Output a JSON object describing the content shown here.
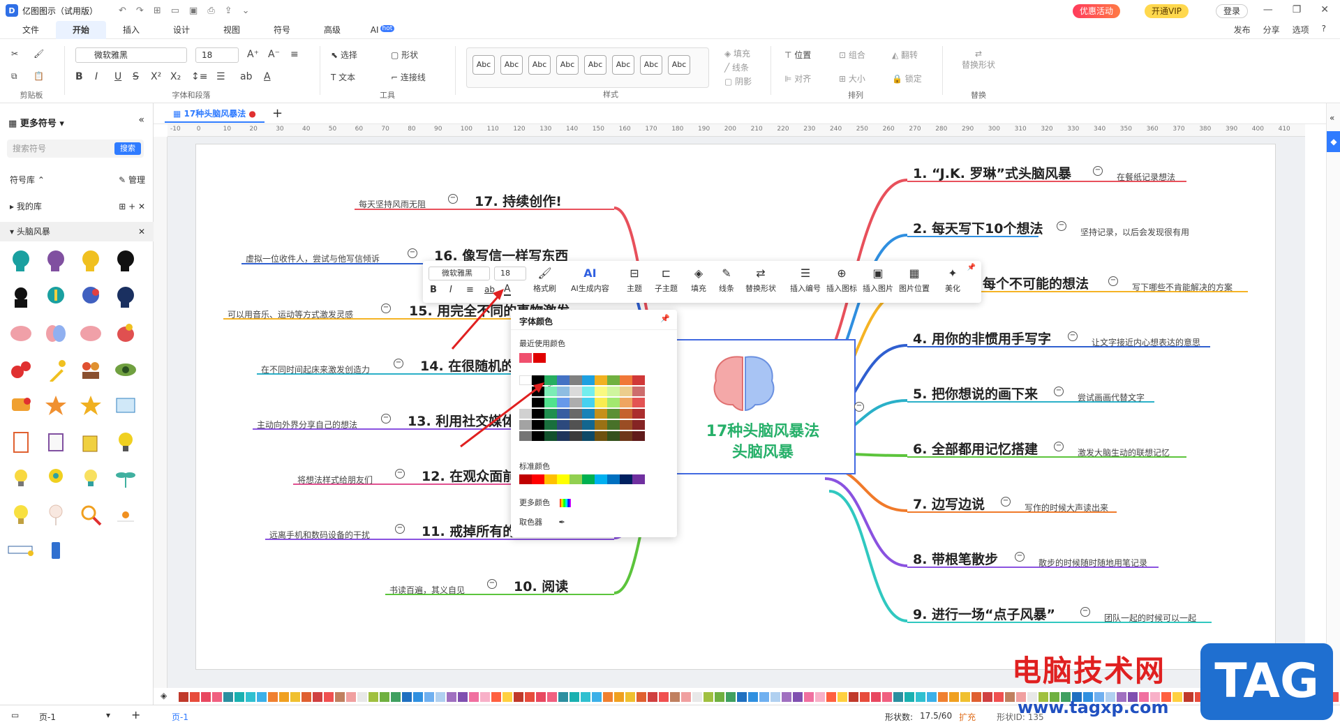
{
  "app": {
    "name": "亿图图示（试用版）",
    "promo": "优惠活动",
    "vip": "开通VIP",
    "login": "登录"
  },
  "menu": {
    "items": [
      "文件",
      "开始",
      "插入",
      "设计",
      "视图",
      "符号",
      "高级",
      "AI"
    ],
    "ai_hot": "hot",
    "right": [
      "发布",
      "分享",
      "选项",
      "?"
    ]
  },
  "ribbon": {
    "font_name": "微软雅黑",
    "font_size": "18",
    "groups": {
      "clipboard": "剪贴板",
      "font": "字体和段落",
      "tools": "工具",
      "styles": "样式",
      "arrange": "排列",
      "replace": "替换"
    },
    "select": "选择",
    "shape": "形状",
    "text": "文本",
    "connector": "连接线",
    "fill": "填充",
    "line": "线条",
    "shadow": "阴影",
    "position": "位置",
    "group": "组合",
    "flip": "翻转",
    "align": "对齐",
    "size": "大小",
    "lock": "锁定",
    "replace_shape": "替换形状",
    "style_sample": "Abc"
  },
  "left_panel": {
    "title": "更多符号",
    "search_placeholder": "搜索符号",
    "search_btn": "搜索",
    "library": "符号库",
    "manage": "管理",
    "my_library": "我的库",
    "category": "头脑风暴"
  },
  "doc": {
    "tab": "17种头脑风暴法"
  },
  "ruler_ticks": [
    "-10",
    "0",
    "10",
    "20",
    "30",
    "40",
    "50",
    "60",
    "70",
    "80",
    "90",
    "100",
    "110",
    "120",
    "130",
    "140",
    "150",
    "160",
    "170",
    "180",
    "190",
    "200",
    "210",
    "220",
    "230",
    "240",
    "250",
    "260",
    "270",
    "280",
    "290",
    "300",
    "310",
    "320",
    "330",
    "340",
    "350",
    "360",
    "370",
    "380",
    "390",
    "400",
    "410"
  ],
  "mindmap": {
    "center_line1": "17种头脑风暴法",
    "center_line2": "头脑风暴",
    "right": [
      {
        "title": "1. “J.K. 罗琳”式头脑风暴",
        "note": "在餐纸记录想法",
        "color": "#e8505b"
      },
      {
        "title": "2. 每天写下10个想法",
        "note": "坚持记录，以后会发现很有用",
        "color": "#2f8fe0"
      },
      {
        "title": "3. 每个不可能的想法",
        "note": "写下哪些不肯能解决的方案",
        "color": "#f5b324"
      },
      {
        "title": "4. 用你的非惯用手写字",
        "note": "让文字接近内心想表达的意思",
        "color": "#2f5fd0"
      },
      {
        "title": "5. 把你想说的画下来",
        "note": "尝试画画代替文字",
        "color": "#2ab0c8"
      },
      {
        "title": "6. 全部都用记忆搭建",
        "note": "激发大脑生动的联想记忆",
        "color": "#5cc43c"
      },
      {
        "title": "7. 边写边说",
        "note": "写作的时候大声读出来",
        "color": "#f07a2a"
      },
      {
        "title": "8. 带根笔散步",
        "note": "散步的时候随时随地用笔记录",
        "color": "#8a52e0"
      },
      {
        "title": "9. 进行一场“点子风暴”",
        "note": "团队一起的时候可以一起",
        "color": "#30c8c0"
      }
    ],
    "left": [
      {
        "title": "17. 持续创作!",
        "note": "每天坚持风雨无阻",
        "color": "#e8505b"
      },
      {
        "title": "16. 像写信一样写东西",
        "note": "虚拟一位收件人，尝试与他写信倾诉",
        "color": "#2f5fd0"
      },
      {
        "title": "15. 用完全不同的事物激发",
        "note": "可以用音乐、运动等方式激发灵感",
        "color": "#f5b324"
      },
      {
        "title": "14. 在很随机的时间起床",
        "note": "在不同时间起床来激发创造力",
        "color": "#2ab0c8"
      },
      {
        "title": "13. 利用社交媒体",
        "note": "主动向外界分享自己的想法",
        "color": "#8a52e0"
      },
      {
        "title": "12. 在观众面前",
        "note": "将想法样式给朋友们",
        "color": "#e05090"
      },
      {
        "title": "11. 戒掉所有的干扰",
        "note": "远离手机和数码设备的干扰",
        "color": "#8a52e0"
      },
      {
        "title": "10. 阅读",
        "note": "书读百遍，其义自见",
        "color": "#5cc43c"
      }
    ]
  },
  "float_toolbar": {
    "font": "微软雅黑",
    "size": "18",
    "items": [
      "格式刷",
      "AI生成内容",
      "主题",
      "子主题",
      "填充",
      "线条",
      "替换形状",
      "插入编号",
      "插入图标",
      "插入图片",
      "图片位置",
      "美化"
    ]
  },
  "color_popup": {
    "title": "字体颜色",
    "recent_label": "最近使用颜色",
    "recent": [
      "#f0506e",
      "#e00000"
    ],
    "theme_top": [
      "#ffffff",
      "#000000",
      "#27ae60",
      "#4472c4",
      "#808080",
      "#1ea0e0",
      "#f0b020",
      "#70b040",
      "#f07838",
      "#d03838"
    ],
    "standard_label": "标准颜色",
    "standard": [
      "#c00000",
      "#ff0000",
      "#ffc000",
      "#ffff00",
      "#92d050",
      "#00b050",
      "#00b0f0",
      "#0070c0",
      "#002060",
      "#7030a0"
    ],
    "more": "更多颜色",
    "picker": "取色器"
  },
  "palette": [
    "#c0392b",
    "#e74c3c",
    "#e84860",
    "#f06080",
    "#2c8fa0",
    "#1ab0b0",
    "#30c0d0",
    "#3cb0e8",
    "#f08030",
    "#f0a020",
    "#f0c030",
    "#e06030",
    "#d04040",
    "#f05050",
    "#c08060",
    "#f0a0a0",
    "#e8e8e8",
    "#a0c040",
    "#70b040",
    "#40a060",
    "#2070c0",
    "#3090e0",
    "#70b0f0",
    "#b0d0f0",
    "#a070c0",
    "#8050b0",
    "#f070a0",
    "#f8b0c8",
    "#ff6040",
    "#ffd040"
  ],
  "status": {
    "page": "页-1",
    "page_tab": "页-1",
    "shapes_label": "形状数:",
    "shapes_value": "17.5/60",
    "expand": "扩充",
    "shape_id": "形状ID: 135"
  },
  "watermark": {
    "text": "电脑技术网",
    "url": "www.tagxp.com",
    "tag": "TAG"
  }
}
